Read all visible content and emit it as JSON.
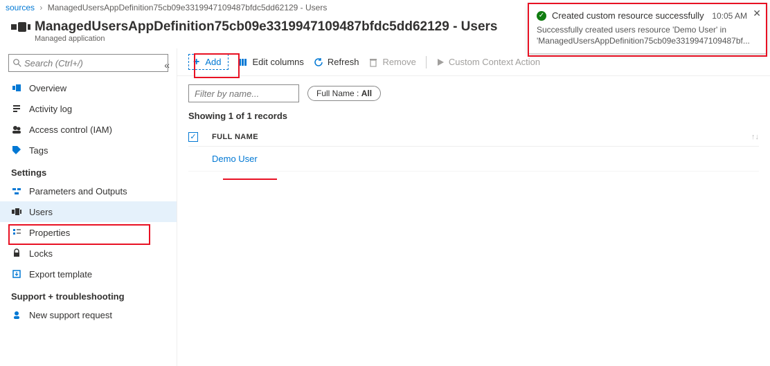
{
  "breadcrumbs": {
    "prev": "sources",
    "current": "ManagedUsersAppDefinition75cb09e3319947109487bfdc5dd62129 - Users"
  },
  "header": {
    "title": "ManagedUsersAppDefinition75cb09e3319947109487bfdc5dd62129 - Users",
    "subtitle": "Managed application"
  },
  "search": {
    "placeholder": "Search (Ctrl+/)"
  },
  "sidebar": {
    "items": [
      {
        "label": "Overview"
      },
      {
        "label": "Activity log"
      },
      {
        "label": "Access control (IAM)"
      },
      {
        "label": "Tags"
      }
    ],
    "settings_header": "Settings",
    "settings": [
      {
        "label": "Parameters and Outputs"
      },
      {
        "label": "Users"
      },
      {
        "label": "Properties"
      },
      {
        "label": "Locks"
      },
      {
        "label": "Export template"
      }
    ],
    "support_header": "Support + troubleshooting",
    "support": [
      {
        "label": "New support request"
      }
    ]
  },
  "toolbar": {
    "add": "Add",
    "edit_columns": "Edit columns",
    "refresh": "Refresh",
    "remove": "Remove",
    "context": "Custom Context Action"
  },
  "filter": {
    "placeholder": "Filter by name...",
    "pill_label": "Full Name :",
    "pill_value": "All"
  },
  "status": "Showing 1 of 1 records",
  "table": {
    "header": "FULL NAME",
    "rows": [
      {
        "name": "Demo User"
      }
    ]
  },
  "toast": {
    "title": "Created custom resource successfully",
    "time": "10:05 AM",
    "body": "Successfully created users resource 'Demo User' in 'ManagedUsersAppDefinition75cb09e3319947109487bf..."
  }
}
